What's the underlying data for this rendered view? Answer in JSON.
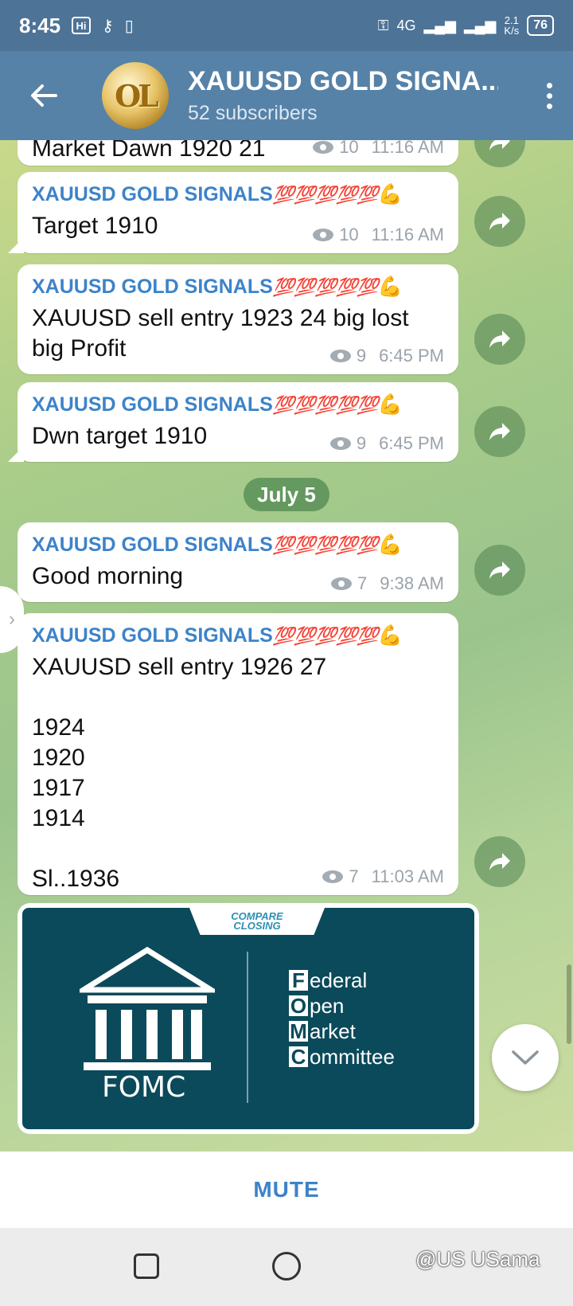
{
  "status_bar": {
    "time": "8:45",
    "network": "4G",
    "speed": "2.1",
    "speed_unit": "K/s",
    "battery": "76"
  },
  "header": {
    "title": "XAUUSD GOLD SIGNA...",
    "subtitle": "52 subscribers",
    "avatar_text": "OL"
  },
  "messages": [
    {
      "sender": "",
      "text": "Market Dawn 1920 21",
      "views": "10",
      "time": "11:16 AM"
    },
    {
      "sender": "XAUUSD GOLD SIGNALS",
      "text": "Target 1910",
      "views": "10",
      "time": "11:16 AM"
    },
    {
      "sender": "XAUUSD GOLD SIGNALS",
      "text": "XAUUSD sell entry 1923 24 big lost big Profit",
      "views": "9",
      "time": "6:45 PM"
    },
    {
      "sender": "XAUUSD GOLD SIGNALS",
      "text": "Dwn target 1910",
      "views": "9",
      "time": "6:45 PM"
    },
    {
      "sender": "XAUUSD GOLD SIGNALS",
      "text": "Good morning",
      "views": "7",
      "time": "9:38 AM"
    },
    {
      "sender": "XAUUSD GOLD SIGNALS",
      "text": "XAUUSD sell entry 1926 27\n\n1924\n1920\n1917\n1914\n\nSl..1936",
      "views": "7",
      "time": "11:03 AM"
    }
  ],
  "sender_emoji": "💯💯💯💯💯",
  "sender_arm": "💪",
  "date_separator": "July 5",
  "image_card": {
    "brand_line1": "COMPARE",
    "brand_line2": "CLOSING",
    "label": "FOMC",
    "lines": [
      {
        "cap": "F",
        "rest": "ederal"
      },
      {
        "cap": "O",
        "rest": "pen"
      },
      {
        "cap": "M",
        "rest": "arket"
      },
      {
        "cap": "C",
        "rest": "ommittee"
      }
    ]
  },
  "bottom": {
    "mute_label": "MUTE"
  },
  "watermark": "@US USama"
}
